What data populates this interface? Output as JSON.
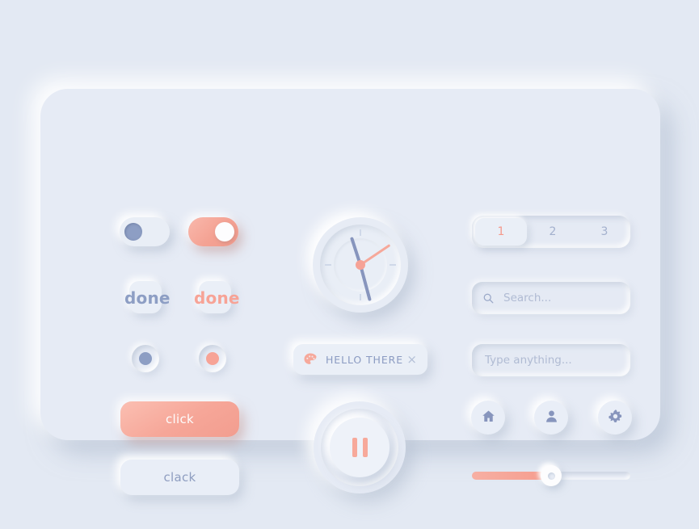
{
  "theme": {
    "background": "#e3e9f3",
    "surface": "#e7ecf5",
    "accent": "#f5a293",
    "text_blue": "#8d9ec4",
    "text_muted": "#a3b0cd"
  },
  "column_left": {
    "toggle_off": {
      "name": "toggle-off",
      "state": "off"
    },
    "toggle_on": {
      "name": "toggle-on",
      "state": "on"
    },
    "checkbox_blue_label": "done",
    "checkbox_pink_label": "done",
    "radio_blue": {
      "state": "selected"
    },
    "radio_pink": {
      "state": "selected"
    },
    "primary_button_label": "click",
    "secondary_button_label": "clack"
  },
  "column_center": {
    "clock": {
      "hour_deg": 162,
      "minute_deg": -15,
      "second_deg": 236,
      "ticks": [
        "12",
        "3",
        "6",
        "9"
      ]
    },
    "chip": {
      "icon": "palette-icon",
      "label": "HELLO THERE",
      "close": "×"
    },
    "media": {
      "icon": "pause-icon",
      "state": "paused"
    }
  },
  "column_right": {
    "tabs": [
      {
        "label": "1",
        "active": true
      },
      {
        "label": "2",
        "active": false
      },
      {
        "label": "3",
        "active": false
      }
    ],
    "search": {
      "icon": "search-icon",
      "value": "",
      "placeholder": "Search..."
    },
    "text_field": {
      "value": "",
      "placeholder": "Type anything..."
    },
    "icon_buttons": [
      {
        "icon": "home-icon"
      },
      {
        "icon": "user-icon"
      },
      {
        "icon": "gear-icon"
      }
    ],
    "slider": {
      "value": 50,
      "min": 0,
      "max": 100
    }
  }
}
